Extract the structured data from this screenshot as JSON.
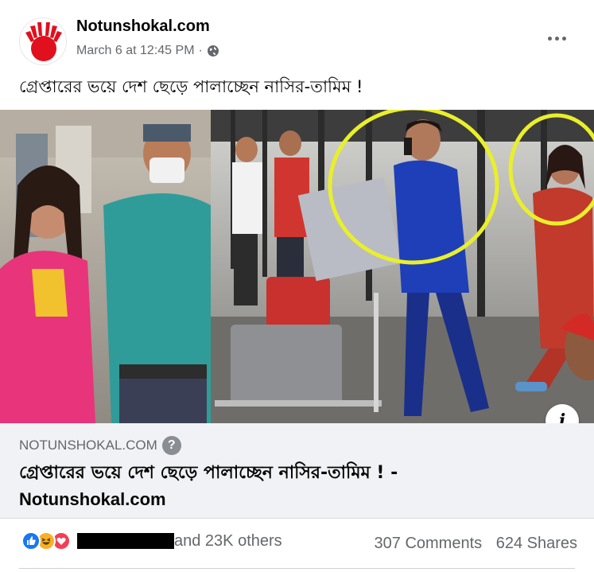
{
  "post": {
    "page_name": "Notunshokal.com",
    "timestamp": "March 6 at 12:45 PM",
    "privacy_icon": "globe-icon",
    "text": "গ্রেপ্তারের ভয়ে দেশ ছেড়ে পালাচ্ছেন নাসির-তামিম !"
  },
  "link_preview": {
    "domain": "NOTUNSHOKAL.COM",
    "title_line1": "গ্রেপ্তারের ভয়ে দেশ ছেড়ে পালাচ্ছেন নাসির-তামিম ! -",
    "title_line2": "Notunshokal.com",
    "info_icon_text": "i",
    "help_icon_text": "?"
  },
  "engagement": {
    "reaction_icons": [
      "like-icon",
      "haha-icon",
      "love-icon"
    ],
    "others_text": "and 23K others",
    "comments": "307 Comments",
    "shares": "624 Shares"
  },
  "colors": {
    "brand_red": "#e0101e",
    "like_blue": "#1877f2",
    "haha_yellow": "#f7b125",
    "love_red": "#f33e58",
    "highlight_circle": "#e9ef2a",
    "police_uniform": "#2f9c9a",
    "blue_suit": "#1f3fb8",
    "pink_dress": "#e8347a"
  }
}
